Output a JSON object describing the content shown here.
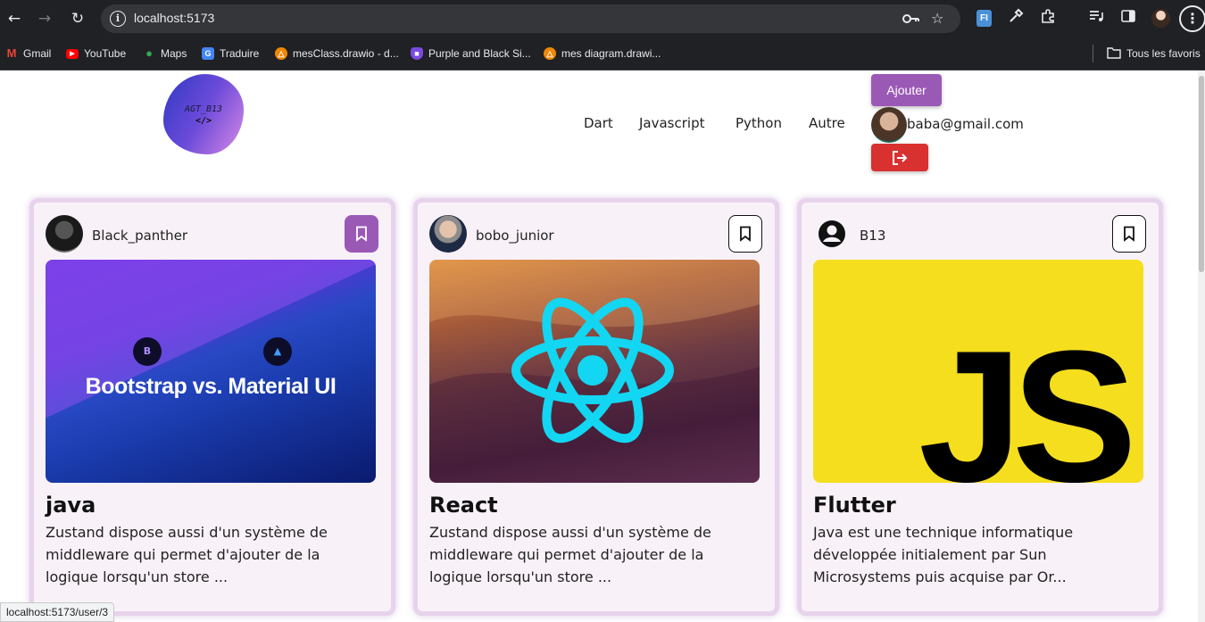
{
  "browser": {
    "url": "localhost:5173",
    "bookmarks": [
      {
        "label": "Gmail",
        "icon": "gmail-icon",
        "color": "#ea4335"
      },
      {
        "label": "YouTube",
        "icon": "youtube-icon",
        "color": "#ff0000"
      },
      {
        "label": "Maps",
        "icon": "maps-pin-icon",
        "color": "#34a853"
      },
      {
        "label": "Traduire",
        "icon": "translate-icon",
        "color": "#4285f4"
      },
      {
        "label": "mesClass.drawio - d...",
        "icon": "drawio-icon",
        "color": "#f08705"
      },
      {
        "label": "Purple and Black Si...",
        "icon": "canva-shield-icon",
        "color": "#7b4ae2"
      },
      {
        "label": "mes diagram.drawi...",
        "icon": "drawio-icon",
        "color": "#f08705"
      }
    ],
    "all_bookmarks_label": "Tous les favoris",
    "extension_label": "FI",
    "status_url": "localhost:5173/user/3"
  },
  "header": {
    "logo_title": "AGT_B13",
    "logo_tag": "</>",
    "nav": [
      "Dart",
      "Javascript",
      "Python",
      "Autre"
    ],
    "add_button": "Ajouter",
    "user_email": "baba@gmail.com",
    "colors": {
      "add_button": "#9b59b6",
      "logout_button": "#d93030"
    }
  },
  "cards": [
    {
      "author": "Black_panther",
      "title": "java",
      "description": "Zustand dispose aussi d'un système de middleware qui permet d'ajouter de la logique lorsqu'un store ...",
      "bookmarked": true,
      "image_text": "Bootstrap vs. Material UI",
      "image_badge_1": "B"
    },
    {
      "author": "bobo_junior",
      "title": "React",
      "description": "Zustand dispose aussi d'un système de middleware qui permet d'ajouter de la logique lorsqu'un store ...",
      "bookmarked": false,
      "image_icon": "react-logo-icon"
    },
    {
      "author": "B13",
      "title": "Flutter",
      "description": "Java est une technique informatique développée initialement par Sun Microsystems puis acquise par Or...",
      "bookmarked": false,
      "image_text": "JS"
    }
  ]
}
